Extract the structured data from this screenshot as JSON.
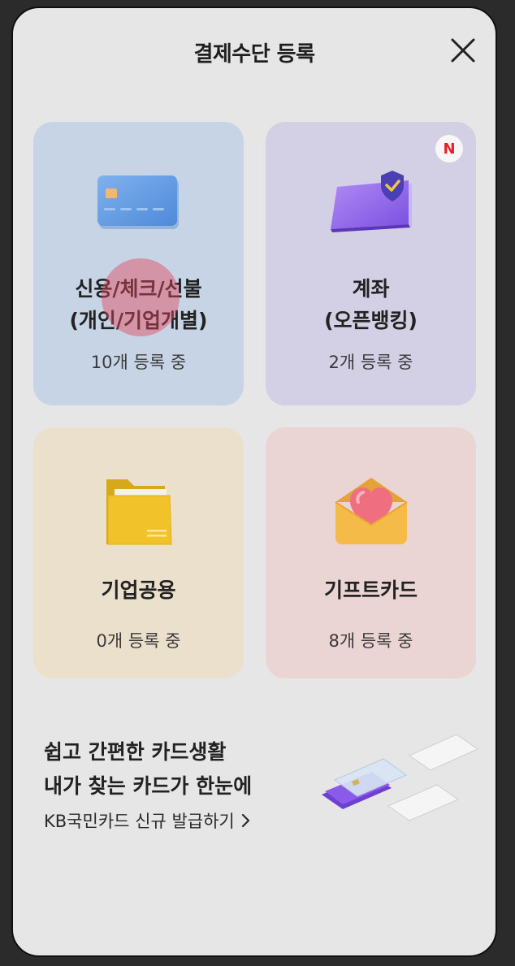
{
  "header": {
    "title": "결제수단 등록",
    "close_icon": "close-icon"
  },
  "tiles": [
    {
      "id": "card",
      "name_line1": "신용/체크/선불",
      "name_line2": "(개인/기업개별)",
      "count": "10개 등록 중",
      "icon": "credit-card-icon",
      "bg": "#c7d4e6"
    },
    {
      "id": "account",
      "name_line1": "계좌",
      "name_line2": "(오픈뱅킹)",
      "count": "2개 등록 중",
      "icon": "bank-account-shield-icon",
      "badge": "N",
      "bg": "#d3cfe4"
    },
    {
      "id": "corporate",
      "name_line1": "기업공용",
      "count": "0개 등록 중",
      "icon": "folder-icon",
      "bg": "#ebe0cc"
    },
    {
      "id": "giftcard",
      "name_line1": "기프트카드",
      "count": "8개 등록 중",
      "icon": "heart-envelope-icon",
      "bg": "#ebd4d4"
    }
  ],
  "promo": {
    "line1": "쉽고 간편한 카드생활",
    "line2": "내가 찾는 카드가 한눈에",
    "link": "KB국민카드 신규 발급하기",
    "link_icon": "chevron-right-icon",
    "art": "card-stack-illustration"
  },
  "colors": {
    "accent_new_badge": "#e8202a",
    "screen_bg": "#e6e6e6"
  }
}
